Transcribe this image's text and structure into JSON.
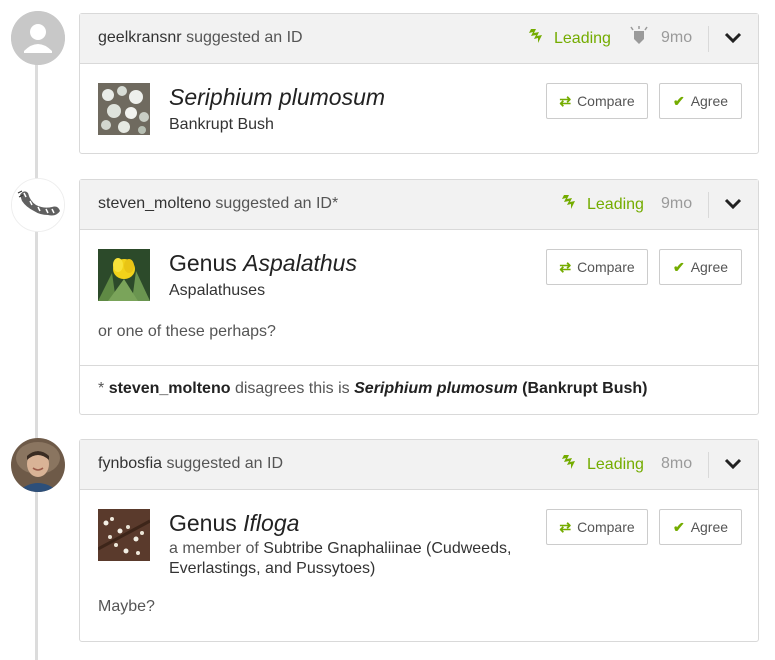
{
  "ids": [
    {
      "user": "geelkransnr",
      "action": "suggested an ID",
      "status": "Leading",
      "time": "9mo",
      "taxon_name": "Seriphium plumosum",
      "common_name": "Bankrupt Bush",
      "compare_label": "Compare",
      "agree_label": "Agree"
    },
    {
      "user": "steven_molteno",
      "action": "suggested an ID*",
      "status": "Leading",
      "time": "9mo",
      "taxon_rank": "Genus",
      "taxon_name": "Aspalathus",
      "common_name": "Aspalathuses",
      "compare_label": "Compare",
      "agree_label": "Agree",
      "comment": "or one of these perhaps?",
      "footnote": {
        "prefix": "*",
        "user": "steven_molteno",
        "text": "disagrees this is",
        "taxon": "Seriphium plumosum",
        "common": "(Bankrupt Bush)"
      }
    },
    {
      "user": "fynbosfia",
      "action": "suggested an ID",
      "status": "Leading",
      "time": "8mo",
      "taxon_rank": "Genus",
      "taxon_name": "Ifloga",
      "member_prefix": "a member of",
      "member_line1": "Subtribe Gnaphaliinae (Cudweeds,",
      "member_line2": "Everlastings, and Pussytoes)",
      "compare_label": "Compare",
      "agree_label": "Agree",
      "comment": "Maybe?"
    }
  ],
  "colors": {
    "accent": "#74ac00",
    "muted": "#9a9a9a",
    "border": "#d9d9d9"
  },
  "icons": [
    "leading-icon",
    "flag-icon",
    "chevron-down-icon",
    "compare-icon",
    "check-icon"
  ]
}
